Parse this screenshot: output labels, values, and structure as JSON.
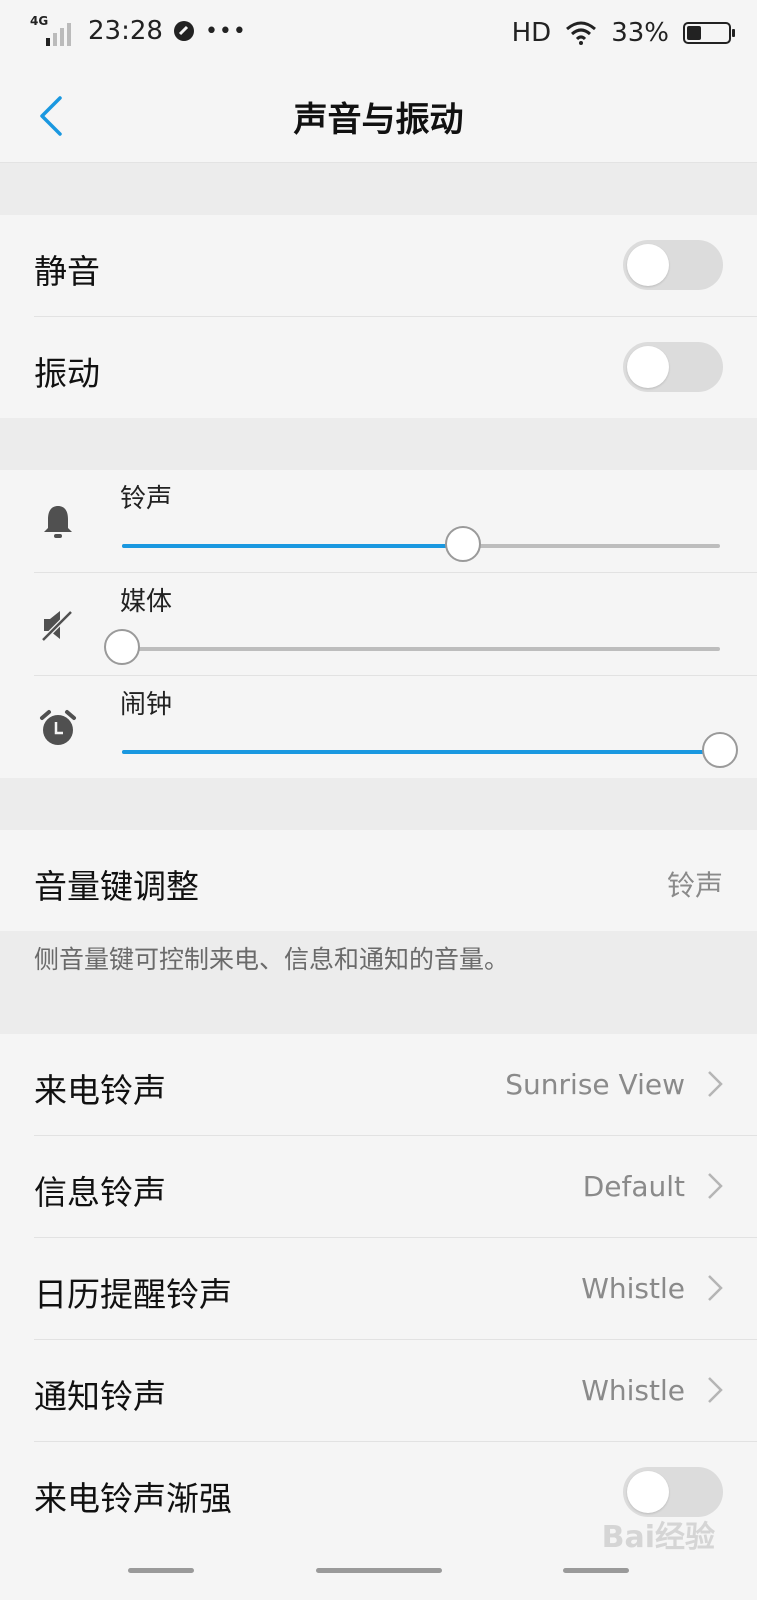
{
  "status_bar": {
    "network": "4G",
    "time": "23:28",
    "hd": "HD",
    "battery": "33%"
  },
  "header": {
    "title": "声音与振动"
  },
  "toggles": {
    "mute": {
      "label": "静音",
      "on": false
    },
    "vibrate": {
      "label": "振动",
      "on": false
    }
  },
  "volumes": {
    "ringtone": {
      "label": "铃声",
      "level": 0.57,
      "icon": "bell-icon"
    },
    "media": {
      "label": "媒体",
      "level": 0.0,
      "icon": "speaker-muted-icon"
    },
    "alarm": {
      "label": "闹钟",
      "level": 1.0,
      "icon": "alarm-clock-icon"
    }
  },
  "volume_keys": {
    "label": "音量键调整",
    "value": "铃声",
    "note": "侧音量键可控制来电、信息和通知的音量。"
  },
  "ringtones": [
    {
      "label": "来电铃声",
      "value": "Sunrise View"
    },
    {
      "label": "信息铃声",
      "value": "Default"
    },
    {
      "label": "日历提醒铃声",
      "value": "Whistle"
    },
    {
      "label": "通知铃声",
      "value": "Whistle"
    }
  ],
  "fade_in": {
    "label": "来电铃声渐强",
    "on": false
  },
  "watermark": "Bai经验",
  "colors": {
    "accent": "#1a98e0",
    "back_arrow": "#1a98e0",
    "background": "#f5f5f5",
    "section_gap": "#ececec"
  }
}
